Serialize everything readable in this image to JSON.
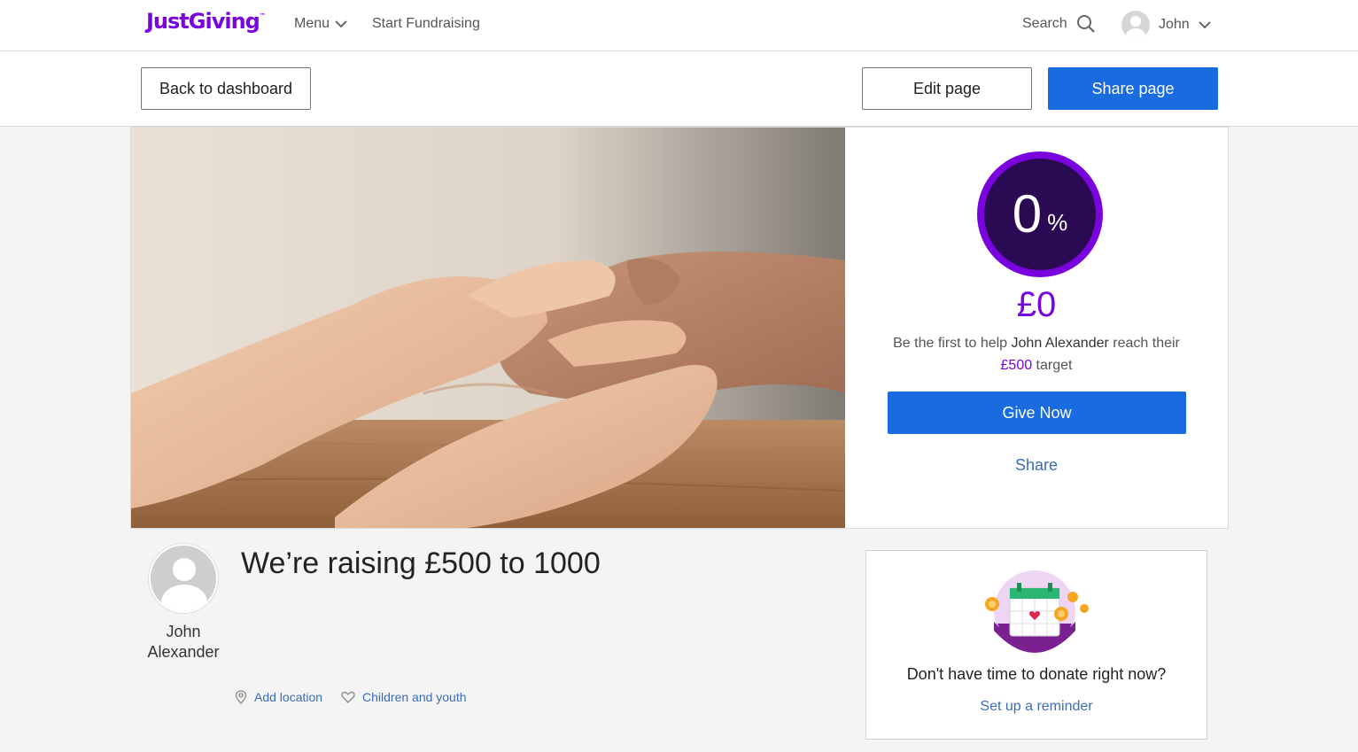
{
  "nav": {
    "logo": "JustGiving",
    "logo_tm": "™",
    "menu_label": "Menu",
    "start_label": "Start Fundraising",
    "search_label": "Search",
    "user_name": "John"
  },
  "actions": {
    "back_label": "Back to dashboard",
    "edit_label": "Edit page",
    "share_label": "Share page"
  },
  "progress": {
    "percent": "0",
    "percent_symbol": "%",
    "raised": "£0",
    "help_prefix": "Be the first to help ",
    "help_name": "John Alexander",
    "help_middle": " reach their ",
    "help_target": "£500",
    "help_suffix": " target",
    "give_label": "Give Now",
    "share_label": "Share"
  },
  "page": {
    "owner_first": "John",
    "owner_last": "Alexander",
    "title": "We’re raising £500 to 1000",
    "location_label": "Add location",
    "category_label": "Children and youth"
  },
  "reminder": {
    "question": "Don't have time to donate right now?",
    "link_label": "Set up a reminder"
  },
  "colors": {
    "brand": "#7a04dd",
    "button_blue": "#1a6ae0",
    "link_blue": "#3c6cb4"
  }
}
